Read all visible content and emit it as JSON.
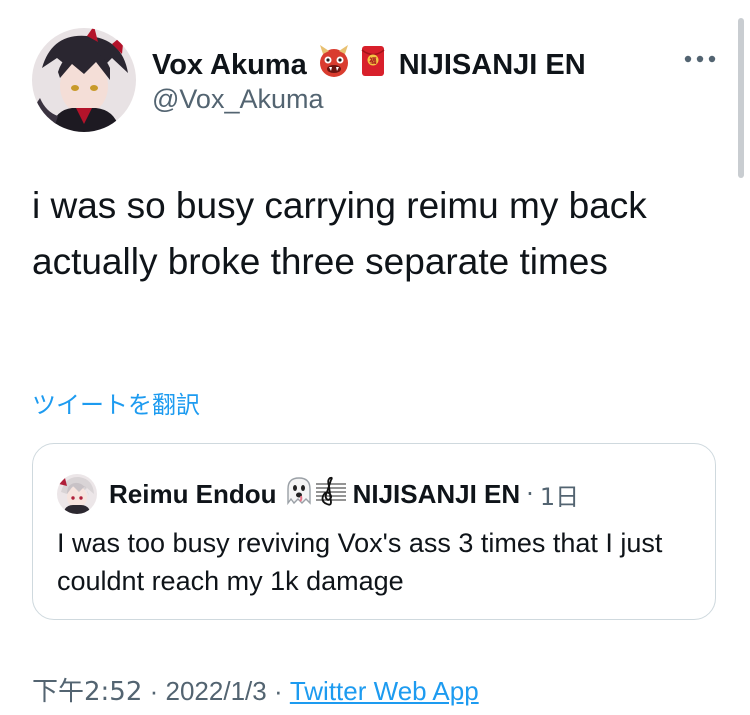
{
  "author": {
    "display_name": "Vox Akuma",
    "affiliation": "NIJISANJI EN",
    "handle": "@Vox_Akuma"
  },
  "tweet": {
    "text": "i was so busy carrying reimu my back actually broke three separate times",
    "translate_label": "ツイートを翻訳"
  },
  "quoted_tweet": {
    "display_name": "Reimu Endou",
    "affiliation": "NIJISANJI EN",
    "time_sep": "·",
    "time": "1日",
    "text": "I was too busy reviving Vox's ass 3 times that I just couldnt reach my 1k damage"
  },
  "meta": {
    "time": "下午2:52",
    "sep1": " · ",
    "date": "2022/1/3",
    "sep2": " · ",
    "source": "Twitter Web App"
  },
  "icons": {
    "name_emoji_1": "ogre-emoji",
    "name_emoji_2": "red-envelope-emoji",
    "quote_emoji_1": "ghost-emoji",
    "quote_emoji_2": "musical-score-emoji",
    "more": "more-dots-icon"
  },
  "colors": {
    "link": "#1d9bf0",
    "secondary_text": "#536471",
    "border": "#cfd9de"
  }
}
